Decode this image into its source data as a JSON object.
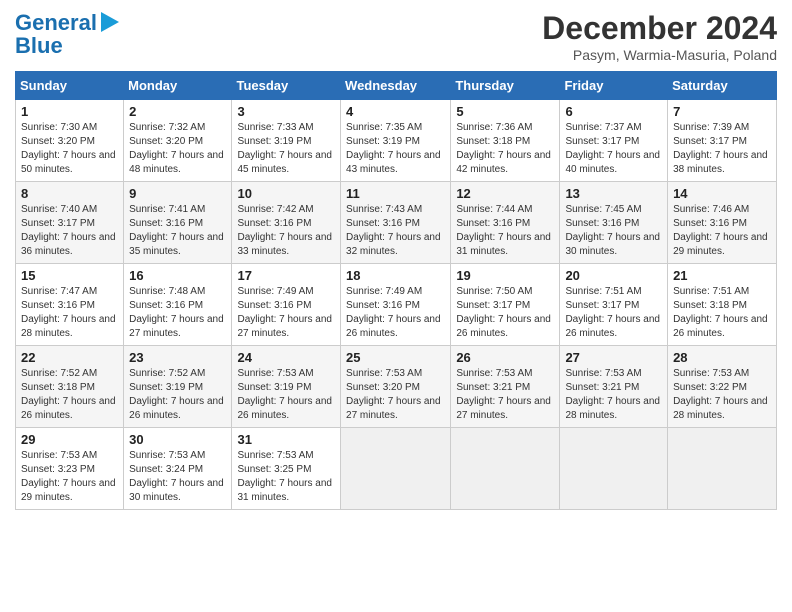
{
  "header": {
    "logo_line1": "General",
    "logo_line2": "Blue",
    "title": "December 2024",
    "subtitle": "Pasym, Warmia-Masuria, Poland"
  },
  "weekdays": [
    "Sunday",
    "Monday",
    "Tuesday",
    "Wednesday",
    "Thursday",
    "Friday",
    "Saturday"
  ],
  "weeks": [
    [
      {
        "day": "1",
        "sunrise": "7:30 AM",
        "sunset": "3:20 PM",
        "daylight": "7 hours and 50 minutes."
      },
      {
        "day": "2",
        "sunrise": "7:32 AM",
        "sunset": "3:20 PM",
        "daylight": "7 hours and 48 minutes."
      },
      {
        "day": "3",
        "sunrise": "7:33 AM",
        "sunset": "3:19 PM",
        "daylight": "7 hours and 45 minutes."
      },
      {
        "day": "4",
        "sunrise": "7:35 AM",
        "sunset": "3:19 PM",
        "daylight": "7 hours and 43 minutes."
      },
      {
        "day": "5",
        "sunrise": "7:36 AM",
        "sunset": "3:18 PM",
        "daylight": "7 hours and 42 minutes."
      },
      {
        "day": "6",
        "sunrise": "7:37 AM",
        "sunset": "3:17 PM",
        "daylight": "7 hours and 40 minutes."
      },
      {
        "day": "7",
        "sunrise": "7:39 AM",
        "sunset": "3:17 PM",
        "daylight": "7 hours and 38 minutes."
      }
    ],
    [
      {
        "day": "8",
        "sunrise": "7:40 AM",
        "sunset": "3:17 PM",
        "daylight": "7 hours and 36 minutes."
      },
      {
        "day": "9",
        "sunrise": "7:41 AM",
        "sunset": "3:16 PM",
        "daylight": "7 hours and 35 minutes."
      },
      {
        "day": "10",
        "sunrise": "7:42 AM",
        "sunset": "3:16 PM",
        "daylight": "7 hours and 33 minutes."
      },
      {
        "day": "11",
        "sunrise": "7:43 AM",
        "sunset": "3:16 PM",
        "daylight": "7 hours and 32 minutes."
      },
      {
        "day": "12",
        "sunrise": "7:44 AM",
        "sunset": "3:16 PM",
        "daylight": "7 hours and 31 minutes."
      },
      {
        "day": "13",
        "sunrise": "7:45 AM",
        "sunset": "3:16 PM",
        "daylight": "7 hours and 30 minutes."
      },
      {
        "day": "14",
        "sunrise": "7:46 AM",
        "sunset": "3:16 PM",
        "daylight": "7 hours and 29 minutes."
      }
    ],
    [
      {
        "day": "15",
        "sunrise": "7:47 AM",
        "sunset": "3:16 PM",
        "daylight": "7 hours and 28 minutes."
      },
      {
        "day": "16",
        "sunrise": "7:48 AM",
        "sunset": "3:16 PM",
        "daylight": "7 hours and 27 minutes."
      },
      {
        "day": "17",
        "sunrise": "7:49 AM",
        "sunset": "3:16 PM",
        "daylight": "7 hours and 27 minutes."
      },
      {
        "day": "18",
        "sunrise": "7:49 AM",
        "sunset": "3:16 PM",
        "daylight": "7 hours and 26 minutes."
      },
      {
        "day": "19",
        "sunrise": "7:50 AM",
        "sunset": "3:17 PM",
        "daylight": "7 hours and 26 minutes."
      },
      {
        "day": "20",
        "sunrise": "7:51 AM",
        "sunset": "3:17 PM",
        "daylight": "7 hours and 26 minutes."
      },
      {
        "day": "21",
        "sunrise": "7:51 AM",
        "sunset": "3:18 PM",
        "daylight": "7 hours and 26 minutes."
      }
    ],
    [
      {
        "day": "22",
        "sunrise": "7:52 AM",
        "sunset": "3:18 PM",
        "daylight": "7 hours and 26 minutes."
      },
      {
        "day": "23",
        "sunrise": "7:52 AM",
        "sunset": "3:19 PM",
        "daylight": "7 hours and 26 minutes."
      },
      {
        "day": "24",
        "sunrise": "7:53 AM",
        "sunset": "3:19 PM",
        "daylight": "7 hours and 26 minutes."
      },
      {
        "day": "25",
        "sunrise": "7:53 AM",
        "sunset": "3:20 PM",
        "daylight": "7 hours and 27 minutes."
      },
      {
        "day": "26",
        "sunrise": "7:53 AM",
        "sunset": "3:21 PM",
        "daylight": "7 hours and 27 minutes."
      },
      {
        "day": "27",
        "sunrise": "7:53 AM",
        "sunset": "3:21 PM",
        "daylight": "7 hours and 28 minutes."
      },
      {
        "day": "28",
        "sunrise": "7:53 AM",
        "sunset": "3:22 PM",
        "daylight": "7 hours and 28 minutes."
      }
    ],
    [
      {
        "day": "29",
        "sunrise": "7:53 AM",
        "sunset": "3:23 PM",
        "daylight": "7 hours and 29 minutes."
      },
      {
        "day": "30",
        "sunrise": "7:53 AM",
        "sunset": "3:24 PM",
        "daylight": "7 hours and 30 minutes."
      },
      {
        "day": "31",
        "sunrise": "7:53 AM",
        "sunset": "3:25 PM",
        "daylight": "7 hours and 31 minutes."
      },
      null,
      null,
      null,
      null
    ]
  ]
}
